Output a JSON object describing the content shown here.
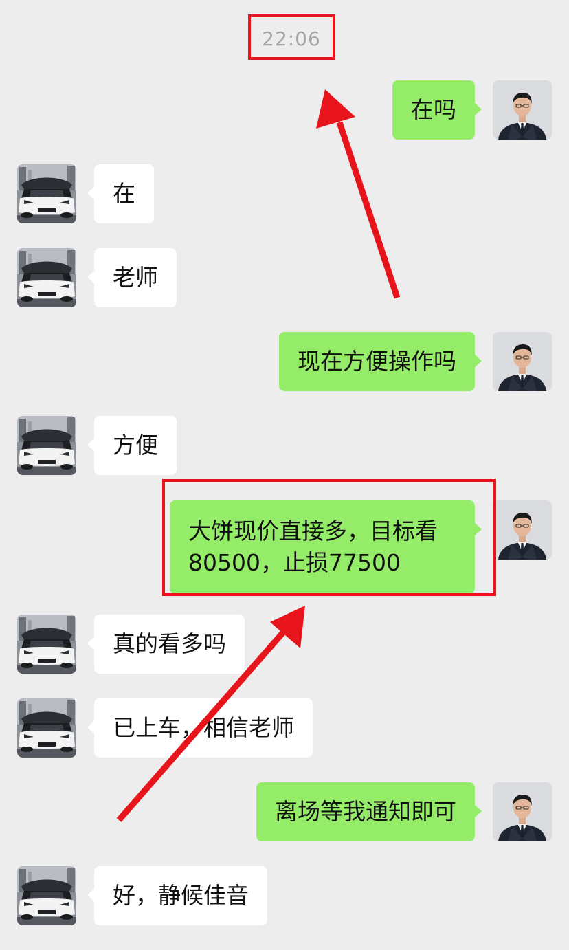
{
  "timestamp": "22:06",
  "messages": [
    {
      "side": "out",
      "text": "在吗"
    },
    {
      "side": "in",
      "text": "在"
    },
    {
      "side": "in",
      "text": "老师"
    },
    {
      "side": "out",
      "text": "现在方便操作吗"
    },
    {
      "side": "in",
      "text": "方便"
    },
    {
      "side": "out",
      "text": "大饼现价直接多，目标看80500，止损77500"
    },
    {
      "side": "in",
      "text": "真的看多吗"
    },
    {
      "side": "in",
      "text": "已上车，相信老师"
    },
    {
      "side": "out",
      "text": "离场等我通知即可"
    },
    {
      "side": "in",
      "text": "好，静候佳音"
    }
  ],
  "colors": {
    "background": "#ededed",
    "outgoing_bubble": "#95ec69",
    "incoming_bubble": "#ffffff",
    "annotation_red": "#e8141b",
    "timestamp_text": "#a6a6a6"
  },
  "icons": {
    "self_avatar": "man-in-suit-avatar",
    "contact_avatar": "sports-car-avatar",
    "annotation": "red-arrow"
  }
}
